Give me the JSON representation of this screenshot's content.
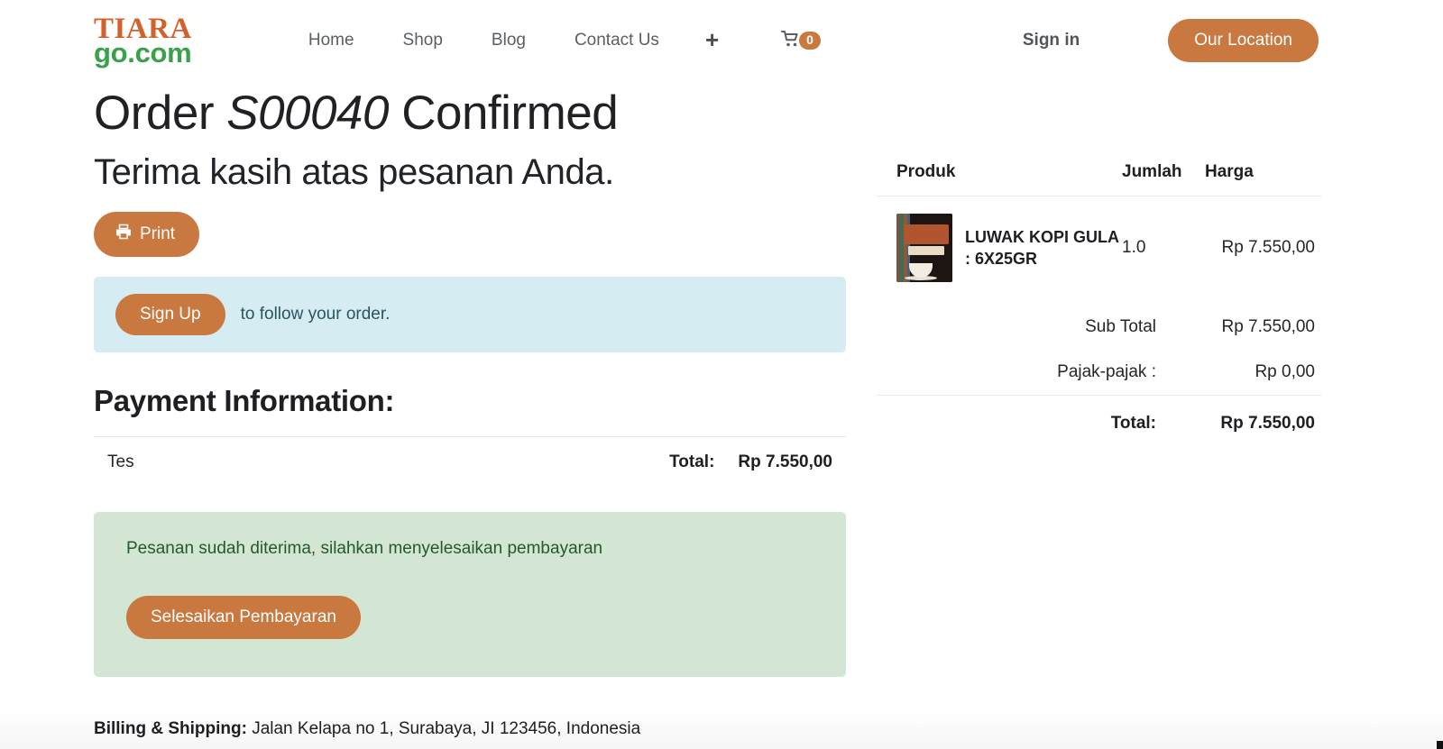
{
  "header": {
    "logo": {
      "top": "TIARA",
      "bottom": "go.com",
      "top_color": "#d4602b",
      "bottom_color": "#3aa049"
    },
    "nav": [
      {
        "label": "Home",
        "name": "nav-home"
      },
      {
        "label": "Shop",
        "name": "nav-shop"
      },
      {
        "label": "Blog",
        "name": "nav-blog"
      },
      {
        "label": "Contact Us",
        "name": "nav-contact-us"
      }
    ],
    "plus_label": "+",
    "cart": {
      "icon": "shopping-cart-icon",
      "count": "0",
      "badge_color": "#c9783f"
    },
    "sign_in_label": "Sign in",
    "location_button_label": "Our Location"
  },
  "order": {
    "title_prefix": "Order",
    "order_number": "S00040",
    "title_suffix": "Confirmed",
    "subtitle": "Terima kasih atas pesanan Anda.",
    "print_button_label": "Print",
    "print_icon": "printer-icon"
  },
  "signup_alert": {
    "button_label": "Sign Up",
    "text": "to follow your order.",
    "background": "#d5ecf2",
    "text_color": "#2c5460"
  },
  "payment": {
    "heading": "Payment Information:",
    "method": "Tes",
    "total_label": "Total:",
    "total_value": "Rp 7.550,00"
  },
  "status_alert": {
    "message": "Pesanan sudah diterima, silahkan menyelesaikan pembayaran",
    "button_label": "Selesaikan Pembayaran",
    "background": "#d3e6d3",
    "text_color": "#24592c"
  },
  "billing": {
    "label": "Billing & Shipping:",
    "address": "Jalan Kelapa no 1, Surabaya, JI 123456, Indonesia"
  },
  "summary": {
    "columns": {
      "product": "Produk",
      "quantity": "Jumlah",
      "price": "Harga"
    },
    "items": [
      {
        "name": "LUWAK KOPI GULA : 6X25GR",
        "quantity": "1.0",
        "price": "Rp 7.550,00",
        "image": "coffee-sachet-pack-image"
      }
    ],
    "subtotal_label": "Sub Total",
    "subtotal_value": "Rp 7.550,00",
    "tax_label": "Pajak-pajak :",
    "tax_value": "Rp 0,00",
    "total_label": "Total:",
    "total_value": "Rp 7.550,00"
  },
  "theme": {
    "accent": "#c9783f",
    "logo_orange": "#d4602b",
    "logo_green": "#3aa049",
    "info_blue": "#d5ecf2",
    "success_green": "#d3e6d3"
  }
}
